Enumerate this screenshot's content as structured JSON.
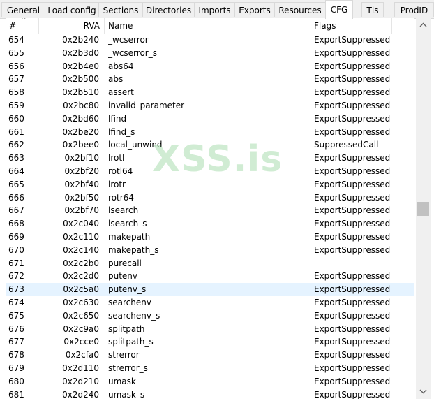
{
  "tabs": [
    {
      "label": "General",
      "active": false
    },
    {
      "label": "Load config",
      "active": false
    },
    {
      "label": "Sections",
      "active": false
    },
    {
      "label": "Directories",
      "active": false
    },
    {
      "label": "Imports",
      "active": false
    },
    {
      "label": "Exports",
      "active": false
    },
    {
      "label": "Resources",
      "active": false
    },
    {
      "label": "CFG",
      "active": true
    },
    {
      "label": "Tls",
      "active": false
    },
    {
      "label": "ProdID",
      "active": false
    }
  ],
  "table": {
    "columns": [
      "#",
      "RVA",
      "Name",
      "Flags"
    ],
    "selected_index": 19,
    "rows": [
      {
        "num": "654",
        "rva": "0x2b240",
        "name": "_wcserror",
        "flags": "ExportSuppressed"
      },
      {
        "num": "655",
        "rva": "0x2b3d0",
        "name": "_wcserror_s",
        "flags": "ExportSuppressed"
      },
      {
        "num": "656",
        "rva": "0x2b4e0",
        "name": "abs64",
        "flags": "ExportSuppressed"
      },
      {
        "num": "657",
        "rva": "0x2b500",
        "name": "abs",
        "flags": "ExportSuppressed"
      },
      {
        "num": "658",
        "rva": "0x2b510",
        "name": "assert",
        "flags": "ExportSuppressed"
      },
      {
        "num": "659",
        "rva": "0x2bc80",
        "name": "invalid_parameter",
        "flags": "ExportSuppressed"
      },
      {
        "num": "660",
        "rva": "0x2bd60",
        "name": "lfind",
        "flags": "ExportSuppressed"
      },
      {
        "num": "661",
        "rva": "0x2be20",
        "name": "lfind_s",
        "flags": "ExportSuppressed"
      },
      {
        "num": "662",
        "rva": "0x2bee0",
        "name": "local_unwind",
        "flags": "SuppressedCall"
      },
      {
        "num": "663",
        "rva": "0x2bf10",
        "name": "lrotl",
        "flags": "ExportSuppressed"
      },
      {
        "num": "664",
        "rva": "0x2bf20",
        "name": "rotl64",
        "flags": "ExportSuppressed"
      },
      {
        "num": "665",
        "rva": "0x2bf40",
        "name": "lrotr",
        "flags": "ExportSuppressed"
      },
      {
        "num": "666",
        "rva": "0x2bf50",
        "name": "rotr64",
        "flags": "ExportSuppressed"
      },
      {
        "num": "667",
        "rva": "0x2bf70",
        "name": "lsearch",
        "flags": "ExportSuppressed"
      },
      {
        "num": "668",
        "rva": "0x2c040",
        "name": "lsearch_s",
        "flags": "ExportSuppressed"
      },
      {
        "num": "669",
        "rva": "0x2c110",
        "name": "makepath",
        "flags": "ExportSuppressed"
      },
      {
        "num": "670",
        "rva": "0x2c140",
        "name": "makepath_s",
        "flags": "ExportSuppressed"
      },
      {
        "num": "671",
        "rva": "0x2c2b0",
        "name": "purecall",
        "flags": ""
      },
      {
        "num": "672",
        "rva": "0x2c2d0",
        "name": "putenv",
        "flags": "ExportSuppressed"
      },
      {
        "num": "673",
        "rva": "0x2c5a0",
        "name": "putenv_s",
        "flags": "ExportSuppressed"
      },
      {
        "num": "674",
        "rva": "0x2c630",
        "name": "searchenv",
        "flags": "ExportSuppressed"
      },
      {
        "num": "675",
        "rva": "0x2c650",
        "name": "searchenv_s",
        "flags": "ExportSuppressed"
      },
      {
        "num": "676",
        "rva": "0x2c9a0",
        "name": "splitpath",
        "flags": "ExportSuppressed"
      },
      {
        "num": "677",
        "rva": "0x2cce0",
        "name": "splitpath_s",
        "flags": "ExportSuppressed"
      },
      {
        "num": "678",
        "rva": "0x2cfa0",
        "name": "strerror",
        "flags": "ExportSuppressed"
      },
      {
        "num": "679",
        "rva": "0x2d110",
        "name": "strerror_s",
        "flags": "ExportSuppressed"
      },
      {
        "num": "680",
        "rva": "0x2d210",
        "name": "umask",
        "flags": "ExportSuppressed"
      },
      {
        "num": "681",
        "rva": "0x2d240",
        "name": "umask_s",
        "flags": "ExportSuppressed"
      }
    ]
  },
  "scrollbar": {
    "up_icon": "chevron-up-icon",
    "down_icon": "chevron-down-icon",
    "position_fraction": 0.5
  },
  "watermark": {
    "text": "XSS.is"
  },
  "colors": {
    "selected_row": "#e5f3ff",
    "watermark": "#78c882",
    "tab_bar": "#f0f0f0"
  }
}
